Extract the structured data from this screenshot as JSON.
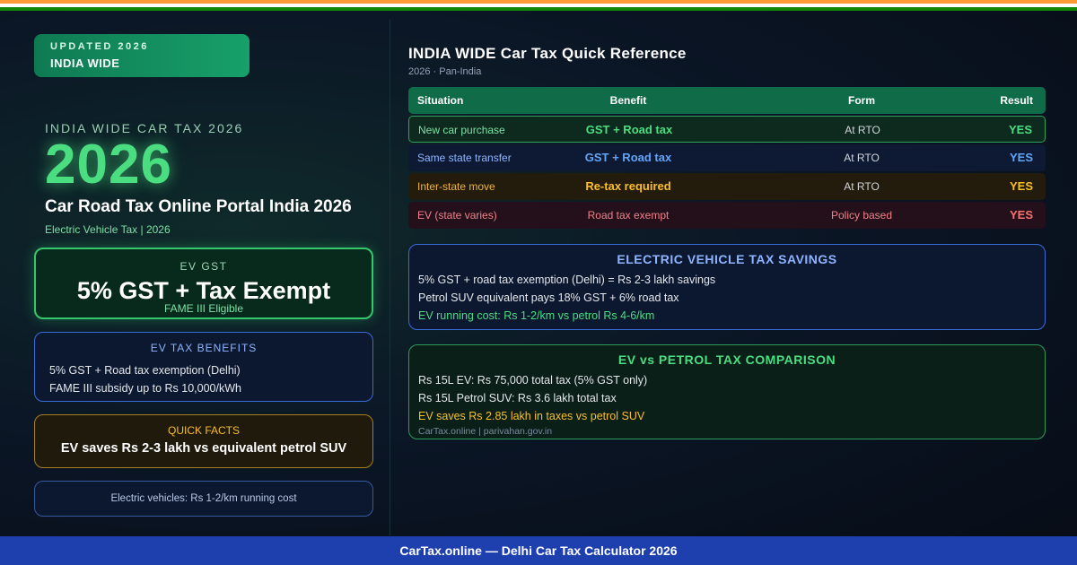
{
  "badge": {
    "line1": "UPDATED 2026",
    "line2": "INDIA WIDE"
  },
  "hero": {
    "eyebrow": "INDIA WIDE CAR TAX 2026",
    "year": "2026",
    "title": "Car Road Tax Online Portal India 2026",
    "subtitle": "Electric Vehicle Tax | 2026"
  },
  "ev_gst": {
    "label": "EV GST",
    "value": "5% GST + Tax Exempt",
    "note": "FAME III Eligible"
  },
  "ev_benefits": {
    "label": "EV TAX BENEFITS",
    "items": [
      "5% GST + Road tax exemption (Delhi)",
      "FAME III subsidy up to Rs 10,000/kWh"
    ]
  },
  "quick_facts": {
    "label": "QUICK FACTS",
    "value": "EV saves Rs 2-3 lakh vs equivalent petrol SUV"
  },
  "running_cost": "Electric vehicles: Rs 1-2/km running cost",
  "reference": {
    "title": "INDIA WIDE Car Tax Quick Reference",
    "subtitle": "2026 · Pan-India",
    "headers": [
      "Situation",
      "Benefit",
      "Form",
      "Result"
    ],
    "rows": [
      {
        "situation": "New car purchase",
        "benefit": "GST + Road tax",
        "form": "At RTO",
        "result": "YES"
      },
      {
        "situation": "Same state transfer",
        "benefit": "GST + Road tax",
        "form": "At RTO",
        "result": "YES"
      },
      {
        "situation": "Inter-state move",
        "benefit": "Re-tax required",
        "form": "At RTO",
        "result": "YES"
      },
      {
        "situation": "EV (state varies)",
        "benefit": "Road tax exempt",
        "form": "Policy based",
        "result": "YES"
      }
    ]
  },
  "ev_savings": {
    "heading": "ELECTRIC VEHICLE TAX SAVINGS",
    "lines": [
      "5% GST + road tax exemption (Delhi) = Rs 2-3 lakh savings",
      "Petrol SUV equivalent pays 18% GST + 6% road tax",
      "EV running cost: Rs 1-2/km vs petrol Rs 4-6/km"
    ]
  },
  "comparison": {
    "heading": "EV vs PETROL TAX COMPARISON",
    "lines": [
      "Rs 15L EV: Rs 75,000 total tax (5% GST only)",
      "Rs 15L Petrol SUV: Rs 3.6 lakh total tax",
      "EV saves Rs 2.85 lakh in taxes vs petrol SUV"
    ],
    "source": "CarTax.online | parivahan.gov.in"
  },
  "footer": "CarTax.online — Delhi Car Tax Calculator 2026",
  "colors": {
    "accent_green": "#4ade80",
    "accent_blue": "#60a5fa",
    "accent_amber": "#fbbf24",
    "accent_red": "#f87171",
    "footer_blue": "#1e40af"
  }
}
